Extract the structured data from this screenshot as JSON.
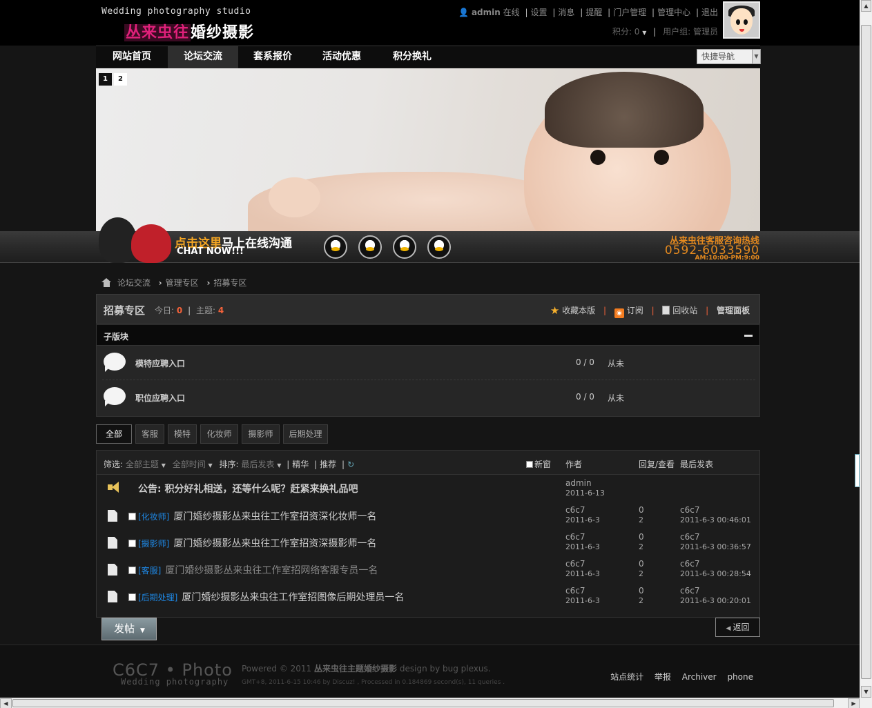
{
  "header": {
    "logo_en": "Wedding photography studio",
    "logo_cn_part1": "丛来虫往",
    "logo_cn_part2": "婚纱摄影",
    "user": {
      "name": "admin",
      "status": "在线",
      "links": [
        "设置",
        "消息",
        "提醒",
        "门户管理",
        "管理中心",
        "退出"
      ],
      "points_label": "积分: 0",
      "group_label": "用户组: 管理员"
    }
  },
  "nav": {
    "items": [
      "网站首页",
      "论坛交流",
      "套系报价",
      "活动优惠",
      "积分换礼"
    ],
    "active_index": 1,
    "quick_nav": "快捷导航"
  },
  "banner": {
    "slides": [
      "1",
      "2"
    ],
    "active_slide": 0
  },
  "chat": {
    "cn_highlight": "点击这里",
    "cn_rest": "马上在线沟通",
    "en": "CHAT NOW!!!",
    "hotline_title": "丛来虫往客服咨询热线",
    "hotline_number": "0592-6033590",
    "hotline_hours": "AM:10:00-PM:9:00"
  },
  "breadcrumb": [
    "论坛交流",
    "管理专区",
    "招募专区"
  ],
  "forum": {
    "title": "招募专区",
    "today_label": "今日:",
    "today_count": "0",
    "threads_label": "主题:",
    "threads_count": "4",
    "actions": [
      "收藏本版",
      "订阅",
      "回收站",
      "管理面板"
    ]
  },
  "subforums": {
    "label": "子版块",
    "items": [
      {
        "name": "模特应聘入口",
        "counts": "0 / 0",
        "last": "从未"
      },
      {
        "name": "职位应聘入口",
        "counts": "0 / 0",
        "last": "从未"
      }
    ]
  },
  "type_tabs": [
    "全部",
    "客服",
    "模特",
    "化妆师",
    "摄影师",
    "后期处理"
  ],
  "thread_list": {
    "filter_label": "筛选:",
    "filter_all_topics": "全部主题",
    "filter_all_time": "全部时间",
    "sort_label": "排序:",
    "sort_value": "最后发表",
    "digest": "精华",
    "recommend": "推荐",
    "new_window": "新窗",
    "col_author": "作者",
    "col_replies": "回复/查看",
    "col_lastpost": "最后发表",
    "announcement": {
      "title": "公告: 积分好礼相送，还等什么呢？赶紧来换礼品吧",
      "author": "admin",
      "date": "2011-6-13"
    },
    "threads": [
      {
        "tag": "[化妆师]",
        "title": "厦门婚纱摄影丛来虫往工作室招资深化妆师一名",
        "author": "c6c7",
        "date": "2011-6-3",
        "replies": "0",
        "views": "2",
        "last_user": "c6c7",
        "last_time": "2011-6-3 00:46:01"
      },
      {
        "tag": "[摄影师]",
        "title": "厦门婚纱摄影丛来虫往工作室招资深摄影师一名",
        "author": "c6c7",
        "date": "2011-6-3",
        "replies": "0",
        "views": "2",
        "last_user": "c6c7",
        "last_time": "2011-6-3 00:36:57"
      },
      {
        "tag": "[客服]",
        "title": "厦门婚纱摄影丛来虫往工作室招网络客服专员一名",
        "author": "c6c7",
        "date": "2011-6-3",
        "replies": "0",
        "views": "2",
        "last_user": "c6c7",
        "last_time": "2011-6-3 00:28:54"
      },
      {
        "tag": "[后期处理]",
        "title": "厦门婚纱摄影丛来虫往工作室招图像后期处理员一名",
        "author": "c6c7",
        "date": "2011-6-3",
        "replies": "0",
        "views": "2",
        "last_user": "c6c7",
        "last_time": "2011-6-3 00:20:01"
      }
    ]
  },
  "buttons": {
    "post": "发帖",
    "back": "返回"
  },
  "footer": {
    "logo": "C6C7 • Photo",
    "logo_sub": "Wedding photography",
    "powered_prefix": "Powered © 2011",
    "powered_brand": "丛来虫往主题婚纱摄影",
    "powered_suffix": "design by bug plexus.",
    "info": "GMT+8, 2011-6-15 10:46 by Discuz! , Processed in 0.184869 second(s), 11 queries .",
    "links": [
      "站点统计",
      "举报",
      "Archiver",
      "phone"
    ]
  },
  "colors": {
    "accent": "#f4623a",
    "tag_blue": "#1e88e5",
    "hotline_orange": "#e58a1f",
    "logo_pink": "#e0207a"
  }
}
